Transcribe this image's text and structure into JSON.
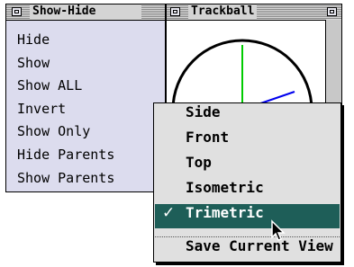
{
  "show_hide_window": {
    "title": "Show-Hide",
    "items": [
      "Hide",
      "Show",
      "Show ALL",
      "Invert",
      "Show Only",
      "Hide Parents",
      "Show Parents"
    ]
  },
  "trackball_window": {
    "title": "Trackball"
  },
  "view_menu": {
    "items": [
      "Side",
      "Front",
      "Top",
      "Isometric",
      "Trimetric"
    ],
    "selected": "Trimetric",
    "check_glyph": "✓",
    "footer_item": "Save Current View"
  },
  "colors": {
    "palette_bg": "#dcdcee",
    "menu_bg": "#e0e0e0",
    "highlight": "#1e5e58",
    "axis_green": "#00cc00",
    "axis_blue": "#0000ee"
  }
}
